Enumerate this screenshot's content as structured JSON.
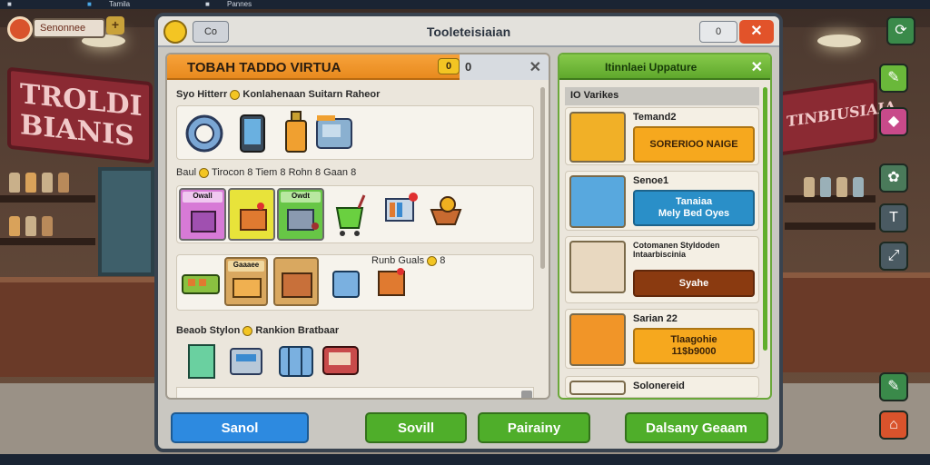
{
  "topbar": {
    "app_label": "Tamila",
    "app_label2": "Pannes"
  },
  "hud": {
    "currency_pill": "Senonnee",
    "plus_label": "+"
  },
  "background": {
    "sign_left": "TROLDI BIANIS",
    "sign_right": "TINBIUSIAIA"
  },
  "window": {
    "title": "Tooleteisiaian",
    "small_btn": "Co",
    "ctrl_label": "0",
    "close_label": "✕"
  },
  "left_panel": {
    "title": "TOBAH TADDO VIRTUA",
    "badge": "0",
    "tail_number": "0",
    "close_label": "✕",
    "section1_label": "Syo Hitterr",
    "section1_label2": "Konlahenaan Suitarn Raheor",
    "row1_labels": [
      "Baul",
      "Tirocon",
      "Tiem",
      "Rohn",
      "Gaan"
    ],
    "row1_nums": [
      "8",
      "8",
      "8",
      "8"
    ],
    "cards": [
      {
        "label": "Owall",
        "color": "#d77ad6"
      },
      {
        "label": "",
        "color": "#e8e33a"
      },
      {
        "label": "Owdt",
        "color": "#67c646"
      }
    ],
    "mid_label": "Runb Guals",
    "mid_badge": "8",
    "row3_card_label": "Gaaaee",
    "section2_label": "Beaob Stylon",
    "section2_label2": "Rankion Bratbaar"
  },
  "right_panel": {
    "title": "Itinnlaei Uppature",
    "subheader": "IO Varikes",
    "items": [
      {
        "name": "Temand2",
        "button": "SORERIOO NAIGE",
        "btn_color": "#f6a81e",
        "btn_text_color": "#3a2208",
        "icon_color": "#f1b027"
      },
      {
        "name": "Senoe1",
        "button": "Tanaiaa\nMely Bed Oyes",
        "btn_color": "#2a8fc8",
        "btn_text_color": "#ffffff",
        "icon_color": "#58a8de"
      },
      {
        "name": "Cotomanen Styldoden\nIntaarbiscinia",
        "button": "Syahe",
        "btn_color": "#8a3a10",
        "btn_text_color": "#ffffff",
        "icon_color": "#e8d8c0"
      },
      {
        "name": "Sarian 22",
        "button": "Tlaagohie\n11$b9000",
        "btn_color": "#f6a81e",
        "btn_text_color": "#3a2208",
        "icon_color": "#f19528"
      },
      {
        "name": "Solonereid",
        "button": "",
        "btn_color": "#f4efe4",
        "btn_text_color": "#222222",
        "icon_color": "#f4efe4"
      }
    ]
  },
  "bottom_buttons": [
    {
      "label": "Sanol",
      "color": "#2d8ae0"
    },
    {
      "label": "Sovill",
      "color": "#4fae2a"
    },
    {
      "label": "Pairainy",
      "color": "#4fae2a"
    },
    {
      "label": "Dalsany Geaam",
      "color": "#4fae2a"
    }
  ]
}
